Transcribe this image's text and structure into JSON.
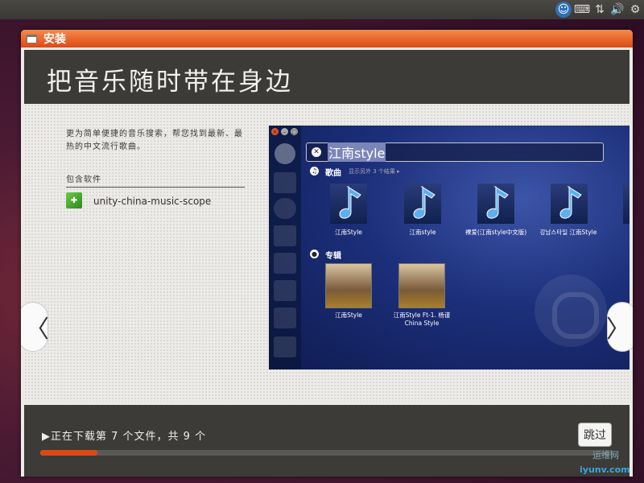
{
  "window": {
    "title": "安装"
  },
  "slide": {
    "title": "把音乐随时带在身边",
    "description": "更为简单便捷的音乐搜索，帮您找到最新、最热的中文流行歌曲。",
    "included_label": "包含软件",
    "package_name": "unity-china-music-scope"
  },
  "nav": {
    "prev": "〈",
    "next": "〉"
  },
  "dash": {
    "query": "江南style",
    "songs_category": "歌曲",
    "songs_more": "显示另外 3 个结果 ▸",
    "songs": [
      "江南Style",
      "江南style",
      "裸爱(江南style中文版)",
      "강남스타일 江南Style"
    ],
    "albums_category": "专辑",
    "albums": [
      {
        "line1": "江南Style",
        "line2": ""
      },
      {
        "line1": "江南Style Ft-1. 杨谨",
        "line2": "China Style"
      }
    ]
  },
  "footer": {
    "status": "▶正在下载第 7 个文件，共 9 个",
    "skip_label": "跳过",
    "progress": 0.1
  },
  "watermark": {
    "line1": "运维网",
    "line2": "iyunv.com"
  },
  "colors": {
    "accent": "#dd4814",
    "panel": "#3c3b37"
  }
}
